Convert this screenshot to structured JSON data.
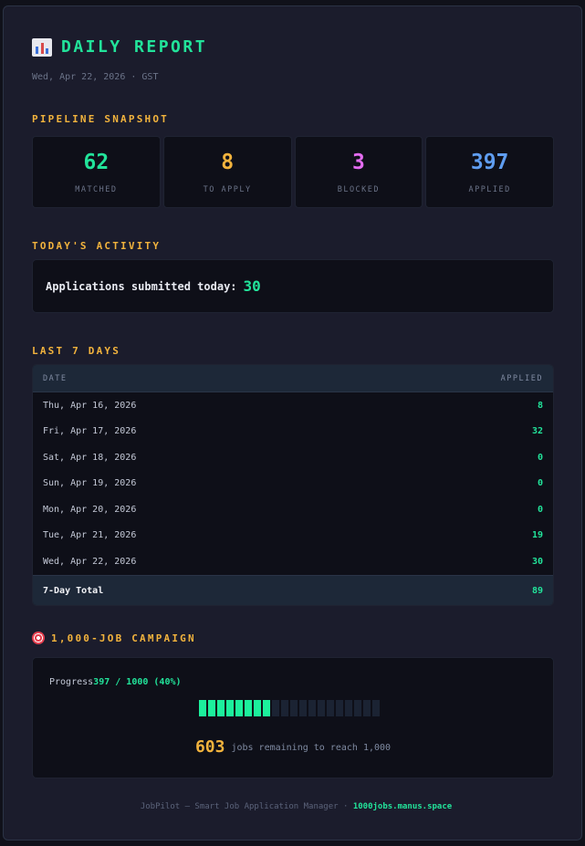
{
  "header": {
    "title": "DAILY REPORT",
    "date_line": "Wed, Apr 22, 2026 · GST"
  },
  "snapshot": {
    "label": "PIPELINE SNAPSHOT",
    "stats": [
      {
        "value": "62",
        "label": "MATCHED",
        "color": "#22e39a"
      },
      {
        "value": "8",
        "label": "TO APPLY",
        "color": "#f2b33d"
      },
      {
        "value": "3",
        "label": "BLOCKED",
        "color": "#e36cf0"
      },
      {
        "value": "397",
        "label": "APPLIED",
        "color": "#5f9df0"
      }
    ]
  },
  "activity": {
    "label": "TODAY'S ACTIVITY",
    "text": "Applications submitted today:",
    "value": "30"
  },
  "last7": {
    "label": "LAST 7 DAYS",
    "columns": [
      "DATE",
      "APPLIED"
    ],
    "rows": [
      {
        "date": "Thu, Apr 16, 2026",
        "applied": "8"
      },
      {
        "date": "Fri, Apr 17, 2026",
        "applied": "32"
      },
      {
        "date": "Sat, Apr 18, 2026",
        "applied": "0"
      },
      {
        "date": "Sun, Apr 19, 2026",
        "applied": "0"
      },
      {
        "date": "Mon, Apr 20, 2026",
        "applied": "0"
      },
      {
        "date": "Tue, Apr 21, 2026",
        "applied": "19"
      },
      {
        "date": "Wed, Apr 22, 2026",
        "applied": "30"
      }
    ],
    "total_label": "7-Day Total",
    "total_value": "89"
  },
  "campaign": {
    "label": "1,000-JOB CAMPAIGN",
    "progress_label": "Progress",
    "progress_value": "397 / 1000 (40%)",
    "progress_fraction": 0.4,
    "remaining_value": "603",
    "remaining_text": "jobs remaining to reach 1,000"
  },
  "footer": {
    "text": "JobPilot — Smart Job Application Manager ·",
    "link": "1000jobs.manus.space"
  },
  "icons": {
    "title": "bar-chart-icon",
    "campaign": "target-icon"
  }
}
